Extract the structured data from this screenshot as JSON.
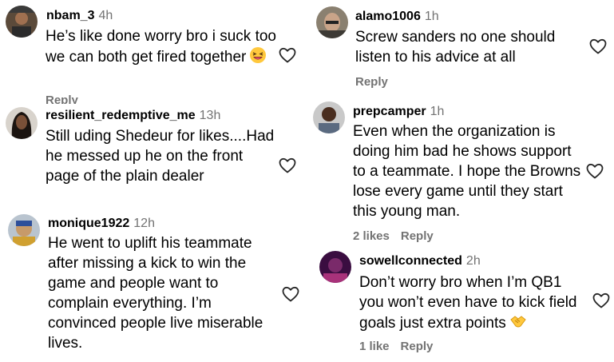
{
  "left": [
    {
      "user": "nbam_3",
      "time": "4h",
      "text": "He’s like done worry bro i suck too we can both get fired together",
      "emoji": "grinning-squinting-face",
      "reply": "Reply"
    },
    {
      "user": "resilient_redemptive_me",
      "time": "13h",
      "text": "Still uding Shedeur for likes....Had he messed up he on the front page of the plain dealer"
    },
    {
      "user": "monique1922",
      "time": "12h",
      "text": "He went to uplift his teammate after missing a kick to win the game and people want to complain everything. I’m convinced people live miserable lives."
    }
  ],
  "right": [
    {
      "user": "alamo1006",
      "time": "1h",
      "text": "Screw sanders no one should listen to his advice at all",
      "reply": "Reply"
    },
    {
      "user": "prepcamper",
      "time": "1h",
      "text": "Even when the organization is doing him bad he shows support to a teammate. I hope the Browns lose every game until they start this young man.",
      "likes": "2 likes",
      "reply": "Reply"
    },
    {
      "user": "sowellconnected",
      "time": "2h",
      "text": "Don’t worry bro when I’m QB1 you won’t even have to kick field goals just extra points",
      "emoji": "handshake",
      "likes": "1 like",
      "reply": "Reply"
    }
  ],
  "colors": {
    "username": "#000000",
    "time": "#737373",
    "text": "#000000",
    "heart": "#262626"
  }
}
